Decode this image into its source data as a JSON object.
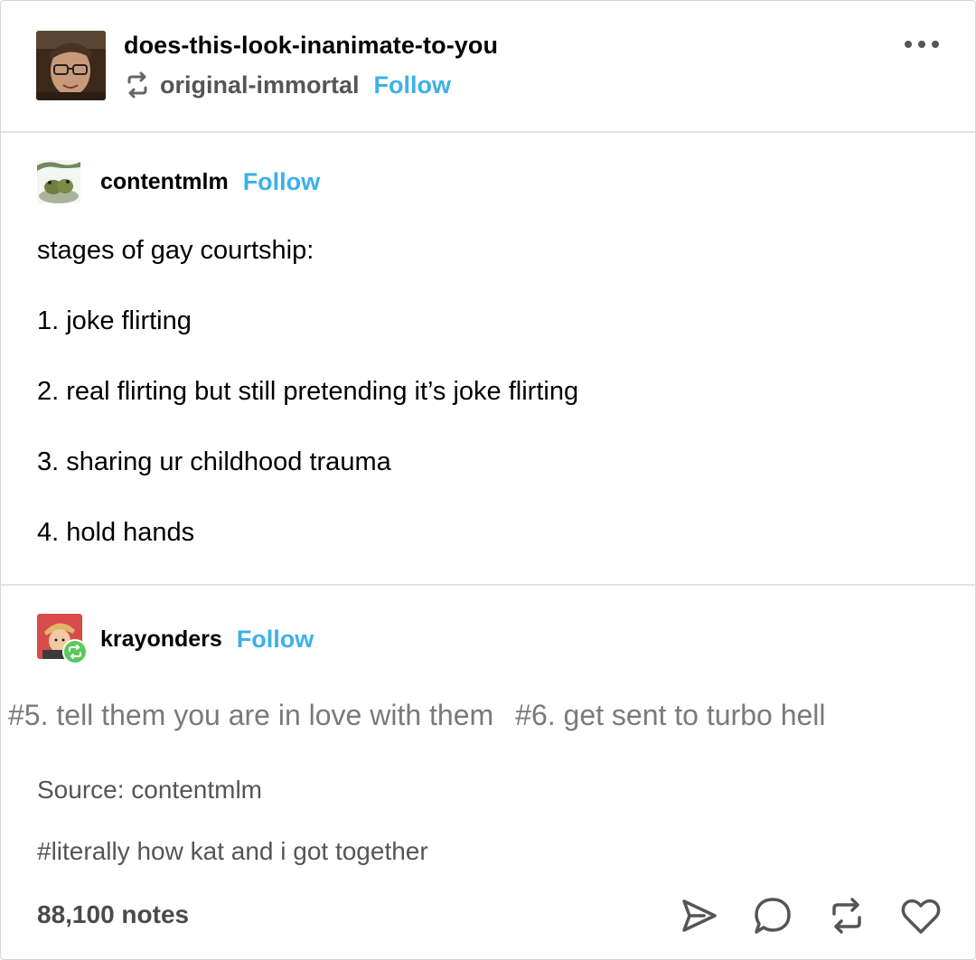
{
  "header": {
    "blog_name": "does-this-look-inanimate-to-you",
    "reblogged_from": "original-immortal",
    "follow_label": "Follow"
  },
  "op": {
    "username": "contentmlm",
    "follow_label": "Follow",
    "lines": [
      "stages of gay courtship:",
      "1. joke flirting",
      "2. real flirting but still pretending it’s joke flirting",
      "3. sharing ur childhood trauma",
      "4. hold hands"
    ]
  },
  "reblogger": {
    "username": "krayonders",
    "follow_label": "Follow",
    "tags": [
      "#5. tell them you are in love with them",
      "#6. get sent to turbo hell"
    ]
  },
  "footer": {
    "source": "Source: contentmlm",
    "hashtag": "#literally how kat and i got together",
    "notes": "88,100 notes"
  },
  "icons": {
    "more": "more-options-icon",
    "reblog": "reblog-icon",
    "share": "share-icon",
    "reply": "reply-icon",
    "like": "heart-icon"
  },
  "colors": {
    "follow": "#3cb0e9",
    "reblog_badge": "#5cc85c"
  }
}
